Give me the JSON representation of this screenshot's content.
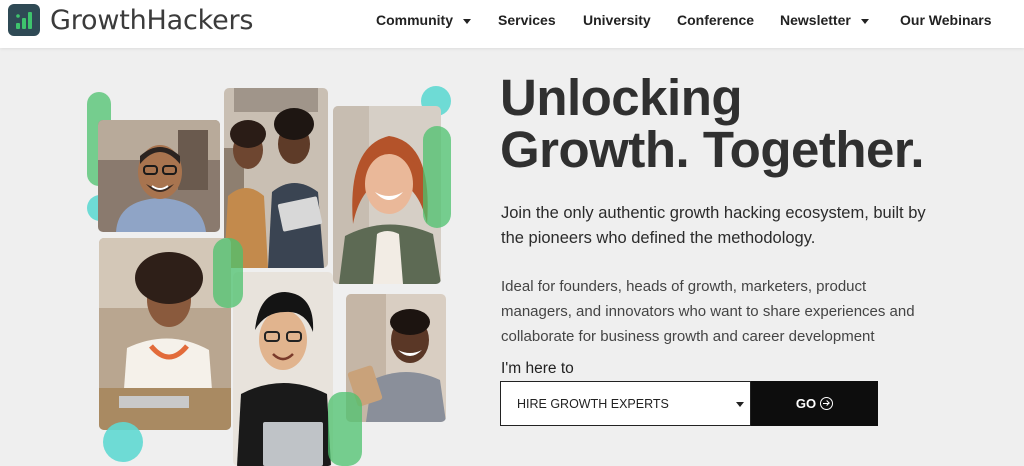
{
  "brand": {
    "name_part1": "Growth",
    "name_part2": "Hackers",
    "logo_color": "#2f4a55",
    "logo_bar_color": "#3ec46d"
  },
  "nav": {
    "items": [
      {
        "label": "Community",
        "has_dropdown": true
      },
      {
        "label": "Services",
        "has_dropdown": false
      },
      {
        "label": "University",
        "has_dropdown": false
      },
      {
        "label": "Conference",
        "has_dropdown": false
      },
      {
        "label": "Newsletter",
        "has_dropdown": true
      },
      {
        "label": "Our Webinars",
        "has_dropdown": false
      }
    ]
  },
  "hero": {
    "title_line1": "Unlocking",
    "title_line2": "Growth. Together.",
    "subtitle": "Join the only authentic growth hacking ecosystem, built by the pioneers who defined the methodology.",
    "description": "Ideal for founders, heads of growth, marketers, product managers, and innovators who want to share experiences and collaborate for business growth and career development"
  },
  "form": {
    "label": "I'm here to",
    "selected_option": "HIRE GROWTH EXPERTS",
    "go_label": "GO"
  },
  "colors": {
    "accent_green": "#4cc16e",
    "accent_teal": "#5fd8d2",
    "button_bg": "#0d0d0d",
    "page_bg": "#efefef"
  },
  "icons": {
    "logo": "bar-chart-logo-icon",
    "dropdown": "chevron-down-icon",
    "go": "arrow-right-circle-icon"
  }
}
